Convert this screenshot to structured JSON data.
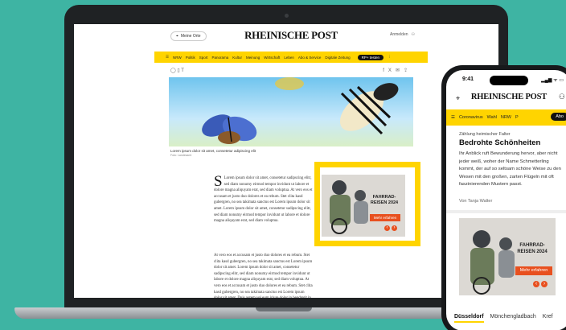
{
  "laptop": {
    "city_button": "Meine Orte",
    "logo": "RHEINISCHE POST",
    "login": "Anmelden",
    "nav_items": [
      "NRW",
      "Politik",
      "Sport",
      "Panorama",
      "Kultur",
      "Meinung",
      "Wirtschaft",
      "Leben",
      "Abo & Service",
      "Digitale Zeitung"
    ],
    "nav_cta": "RP+ testen",
    "caption": "Lorem ipsum dolor sit amet, consetetur adipiscing elit",
    "caption_credit": "Foto: Landesamt",
    "dropcap": "S",
    "paragraph_1": "Lorem ipsum dolor sit amet, consetetur sadipscing elitr, sed diam nonumy eirmod tempor invidunt ut labore et dolore magna aliquyam erat, sed diam voluptua. At vero eos et accusam et justo duo dolores et ea rebum. Stet clita kasd gubergren, no sea takimata sanctus est Lorem ipsum dolor sit amet. Lorem ipsum dolor sit amet, consetetur sadipscing elitr, sed diam nonumy eirmod tempor invidunt ut labore et dolore magna aliquyam erat, sed diam voluptua.",
    "paragraph_2": "At vero eos et accusam et justo duo dolores et ea rebum. Stet clita kasd gubergren, no sea takimata sanctus est Lorem ipsum dolor sit amet. Lorem ipsum dolor sit amet, consetetur sadipscing elitr, sed diam nonumy eirmod tempor invidunt ut labore et dolore magna aliquyam erat, sed diam voluptua. At vero eos et accusam et justo duo dolores et ea rebum. Stet clita kasd gubergren, no sea takimata sanctus est Lorem ipsum dolor sit amet. Duis autem vel eum iriure dolor in hendrerit in"
  },
  "ad": {
    "title_line1": "FAHRRAD-",
    "title_line2": "REISEN 2024",
    "cta": "Mehr erfahren",
    "prev_icon": "‹",
    "next_icon": "›",
    "accent_color": "#e8501f",
    "highlight_color": "#ffd400"
  },
  "phone": {
    "time": "9:41",
    "status_icons": "▂▄▆ ᯤ ▭",
    "logo": "RHEINISCHE POST",
    "nav_items": [
      "Coronavirus",
      "Wahl",
      "NRW",
      "P"
    ],
    "abo": "Abo",
    "kicker": "Zählung heimischer Falter",
    "headline": "Bedrohte Schönheiten",
    "teaser": "Ihr Anblick ruft Bewunderung hervor, aber nicht jeder weiß, woher der Name Schmetterling kommt, der auf so seltsam schöne Weise zu den Wesen mit den großen, zarten Flügeln mit oft faszinierenden Mustern passt.",
    "author": "Von Tanja Walter",
    "tabs": [
      "Düsseldorf",
      "Mönchengladbach",
      "Kref"
    ]
  },
  "colors": {
    "background": "#3eb4a3",
    "brand_yellow": "#ffd400"
  }
}
